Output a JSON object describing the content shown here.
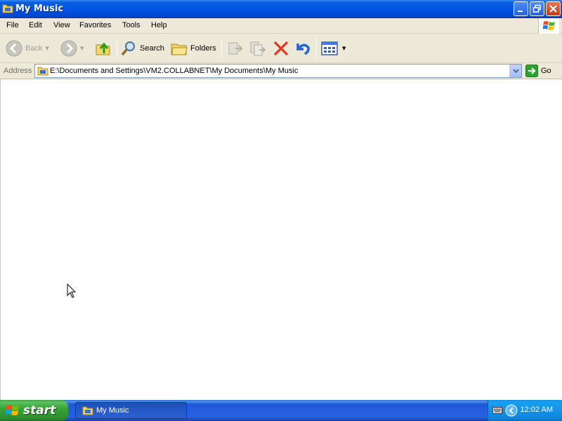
{
  "window": {
    "title": "My Music"
  },
  "menu": {
    "items": [
      "File",
      "Edit",
      "View",
      "Favorites",
      "Tools",
      "Help"
    ]
  },
  "toolbar": {
    "back_label": "Back",
    "search_label": "Search",
    "folders_label": "Folders"
  },
  "address": {
    "label": "Address",
    "value": "E:\\Documents and Settings\\VM2.COLLABNET\\My Documents\\My Music",
    "go_label": "Go"
  },
  "taskbar": {
    "start_label": "start",
    "task_label": "My Music",
    "clock": "12:02 AM"
  },
  "colors": {
    "titlebar": "#0054e3",
    "chrome": "#ece9d8",
    "taskbar": "#245edb",
    "start": "#37a437"
  }
}
